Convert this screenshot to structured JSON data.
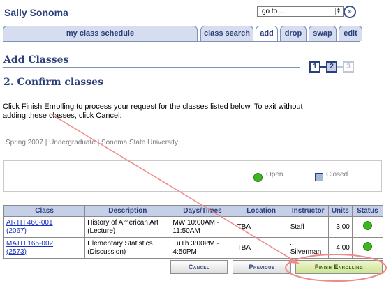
{
  "header": {
    "student_name": "Sally Sonoma",
    "goto_value": "go to ...",
    "goto_button_icon": "double-chevron-right-icon"
  },
  "tabs": [
    {
      "label": "my class schedule",
      "active": false
    },
    {
      "label": "class search",
      "active": false
    },
    {
      "label": "add",
      "active": true
    },
    {
      "label": "drop",
      "active": false
    },
    {
      "label": "swap",
      "active": false
    },
    {
      "label": "edit",
      "active": false
    }
  ],
  "page": {
    "section_title": "Add Classes",
    "sub_title": "2.  Confirm classes",
    "steps": [
      "1",
      "2",
      "3"
    ],
    "current_step": "2",
    "instructions": "Click Finish Enrolling to process your request for the classes listed below. To exit without adding these classes, click Cancel.",
    "term_line": "Spring 2007 | Undergraduate | Sonoma State University"
  },
  "legend": {
    "open_label": "Open",
    "closed_label": "Closed",
    "colors": {
      "open": "#3cb521",
      "closed": "#a3b7d9"
    }
  },
  "table": {
    "headers": [
      "Class",
      "Description",
      "Days/Times",
      "Location",
      "Instructor",
      "Units",
      "Status"
    ],
    "rows": [
      {
        "class_line1": "ARTH 460-001",
        "class_line2": "(2067)",
        "description": "History of American Art (Lecture)",
        "days_times": "MW 10:00AM - 11:50AM",
        "location": "TBA",
        "instructor": "Staff",
        "units": "3.00",
        "status": "Open"
      },
      {
        "class_line1": "MATH 165-002",
        "class_line2": "(2573)",
        "description": "Elementary Statistics (Discussion)",
        "days_times": "TuTh 3:00PM - 4:50PM",
        "location": "TBA",
        "instructor": "J. Silverman",
        "units": "4.00",
        "status": "Open"
      }
    ]
  },
  "buttons": {
    "cancel": "Cancel",
    "previous": "Previous",
    "finish": "Finish Enrolling"
  },
  "annotation_color": "#f08a8a"
}
